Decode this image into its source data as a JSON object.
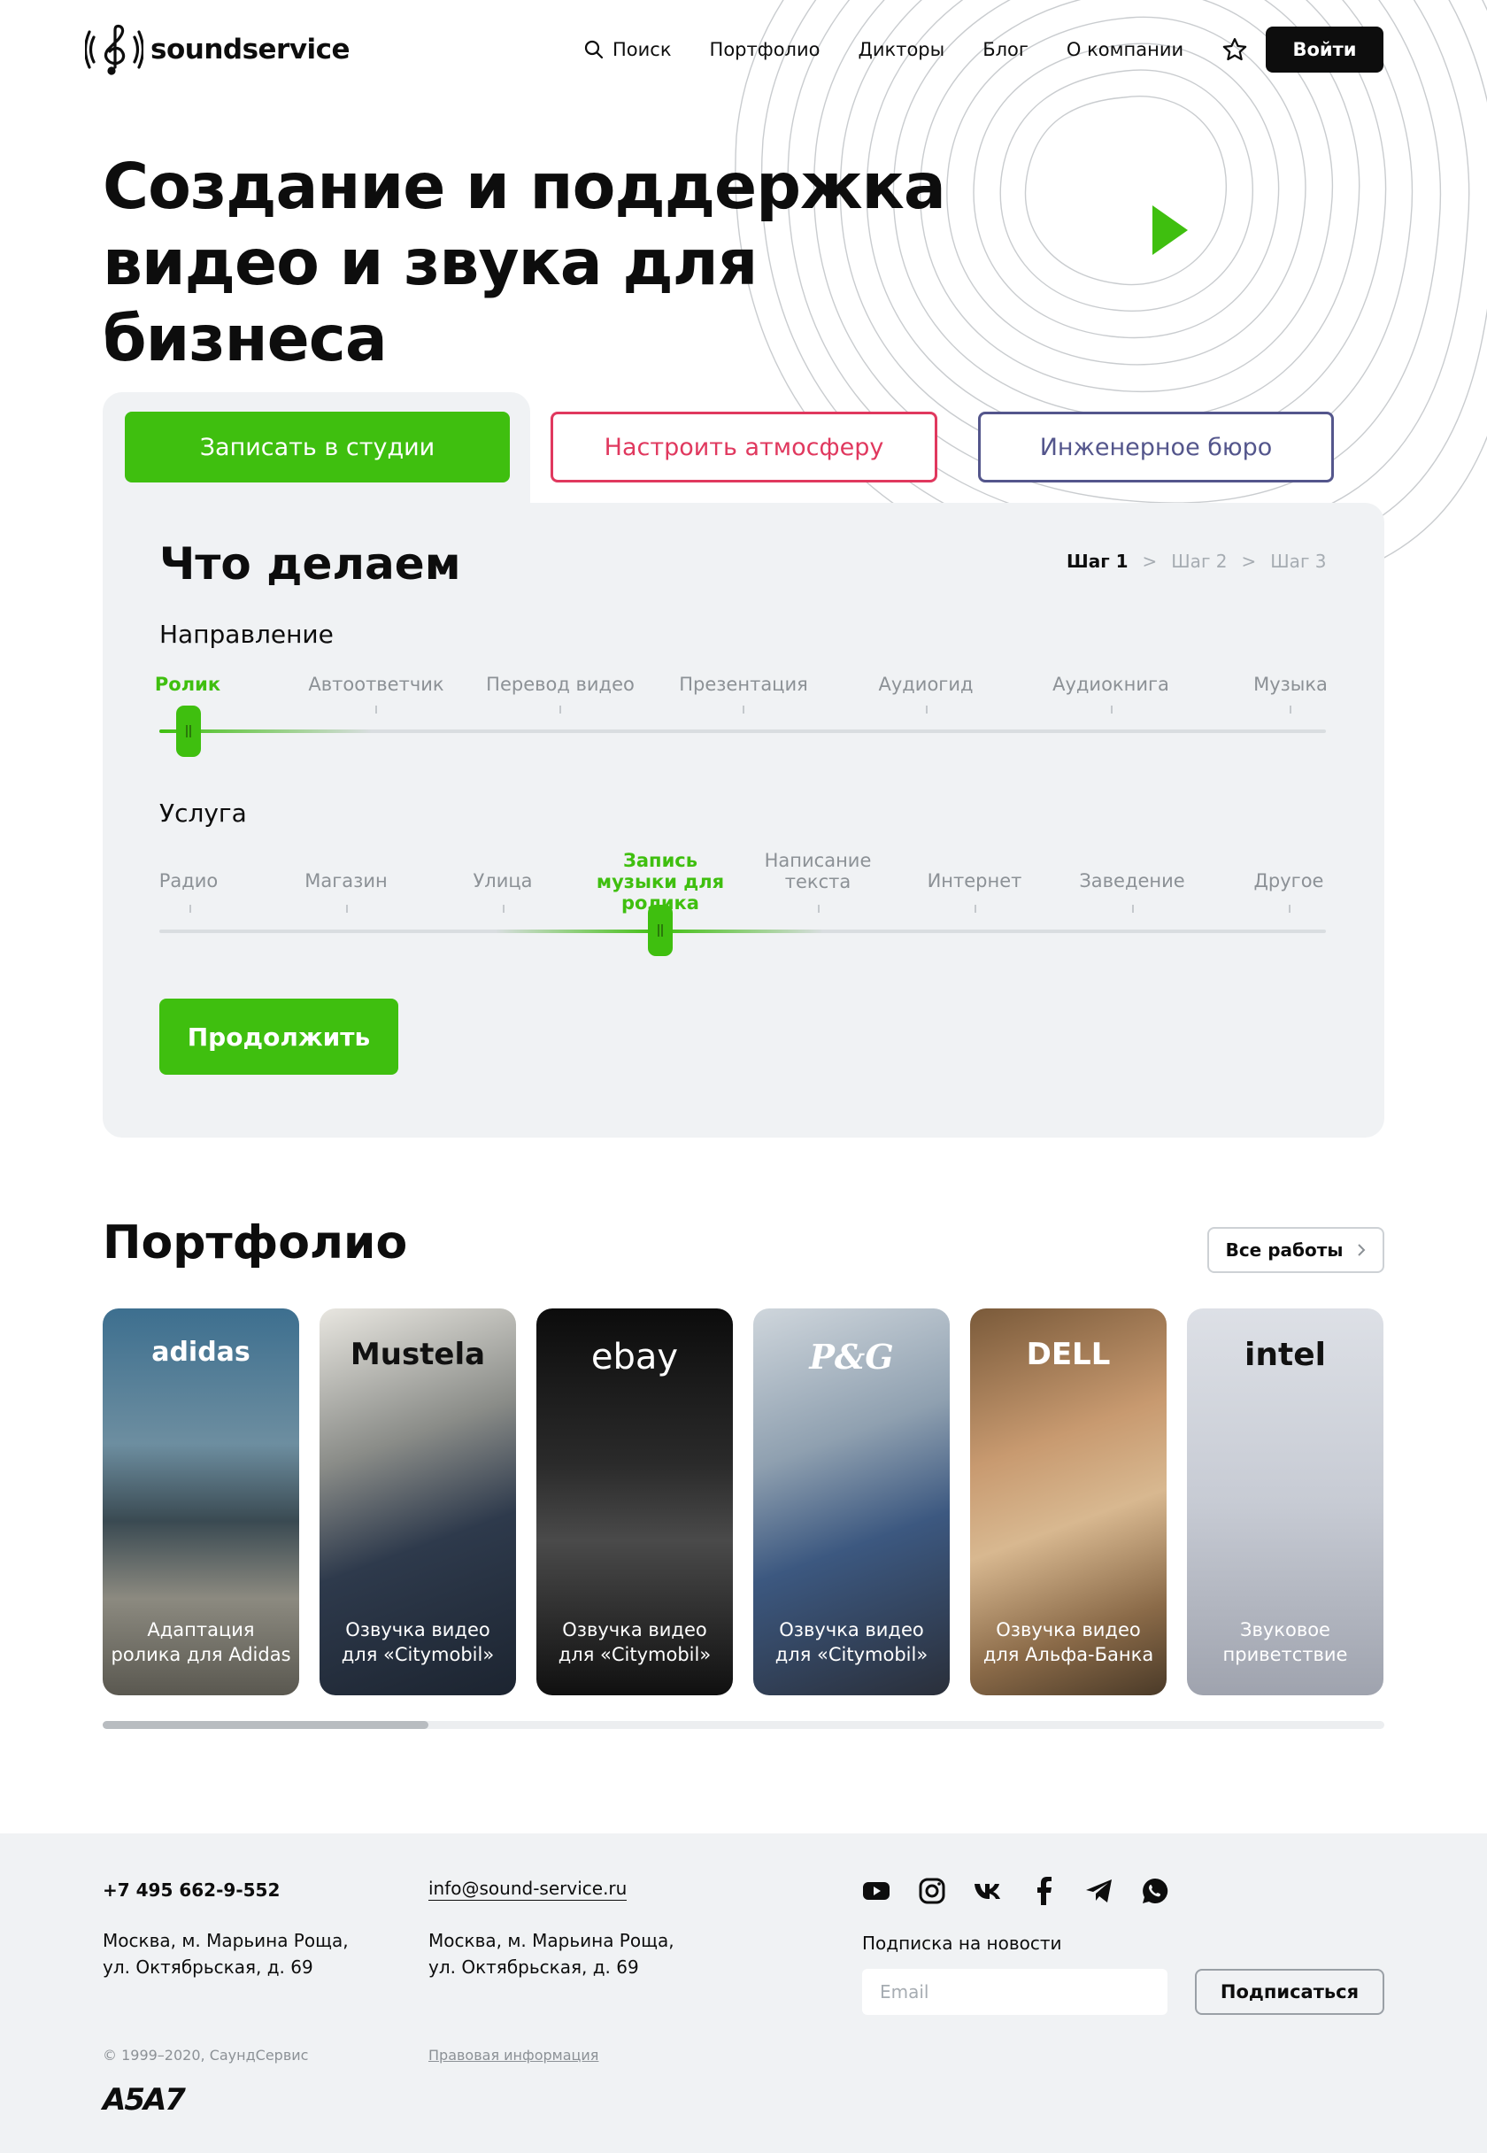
{
  "header": {
    "logo_text": "soundservice",
    "nav": [
      {
        "label": "Поиск"
      },
      {
        "label": "Портфолио"
      },
      {
        "label": "Дикторы"
      },
      {
        "label": "Блог"
      },
      {
        "label": "О компании"
      }
    ],
    "login_label": "Войти"
  },
  "hero": {
    "title_line1": "Создание и поддержка",
    "title_line2": "видео и звука для бизнеса"
  },
  "tabs": [
    {
      "label": "Записать в студии"
    },
    {
      "label": "Настроить атмосферу"
    },
    {
      "label": "Инженерное бюро"
    }
  ],
  "calculator": {
    "title": "Что делаем",
    "steps": [
      "Шаг 1",
      "Шаг 2",
      "Шаг 3"
    ],
    "direction": {
      "label": "Направление",
      "options": [
        "Ролик",
        "Автоответчик",
        "Перевод видео",
        "Презентация",
        "Аудиогид",
        "Аудиокнига",
        "Музыка"
      ],
      "selected": "Ролик"
    },
    "service": {
      "label": "Услуга",
      "options": [
        "Радио",
        "Магазин",
        "Улица",
        "Запись музыки для ролика",
        "Написание текста",
        "Интернет",
        "Заведение",
        "Другое"
      ],
      "selected": "Запись музыки для ролика"
    },
    "continue_label": "Продолжить"
  },
  "portfolio": {
    "title": "Портфолио",
    "all_label": "Все работы",
    "cards": [
      {
        "brand": "adidas",
        "caption": "Адаптация ролика для Adidas"
      },
      {
        "brand": "Mustela",
        "caption": "Озвучка видео для «Citymobil»"
      },
      {
        "brand": "ebay",
        "caption": "Озвучка видео для «Citymobil»"
      },
      {
        "brand": "P&G",
        "caption": "Озвучка видео для «Citymobil»"
      },
      {
        "brand": "DELL",
        "caption": "Озвучка видео для Альфа-Банка"
      },
      {
        "brand": "intel",
        "caption": "Звуковое приветствие"
      }
    ],
    "scroll_fraction": 0.25
  },
  "footer": {
    "phone": "+7 495 662-9-552",
    "email": "info@sound-service.ru",
    "address1": "Москва, м. Марьина Роща,",
    "address2": "ул. Октябрьская, д. 69",
    "copyright": "© 1999–2020, СаундСервис",
    "legal": "Правовая информация",
    "subscribe_label": "Подписка на новости",
    "email_placeholder": "Email",
    "subscribe_button": "Подписаться",
    "agency_logo": "A5A7",
    "social": [
      "youtube-icon",
      "instagram-icon",
      "vk-icon",
      "facebook-icon",
      "telegram-icon",
      "whatsapp-icon"
    ]
  },
  "colors": {
    "accent": "#3fbf0f",
    "pink": "#e0385e",
    "indigo": "#54568c",
    "panel": "#f0f2f4"
  }
}
